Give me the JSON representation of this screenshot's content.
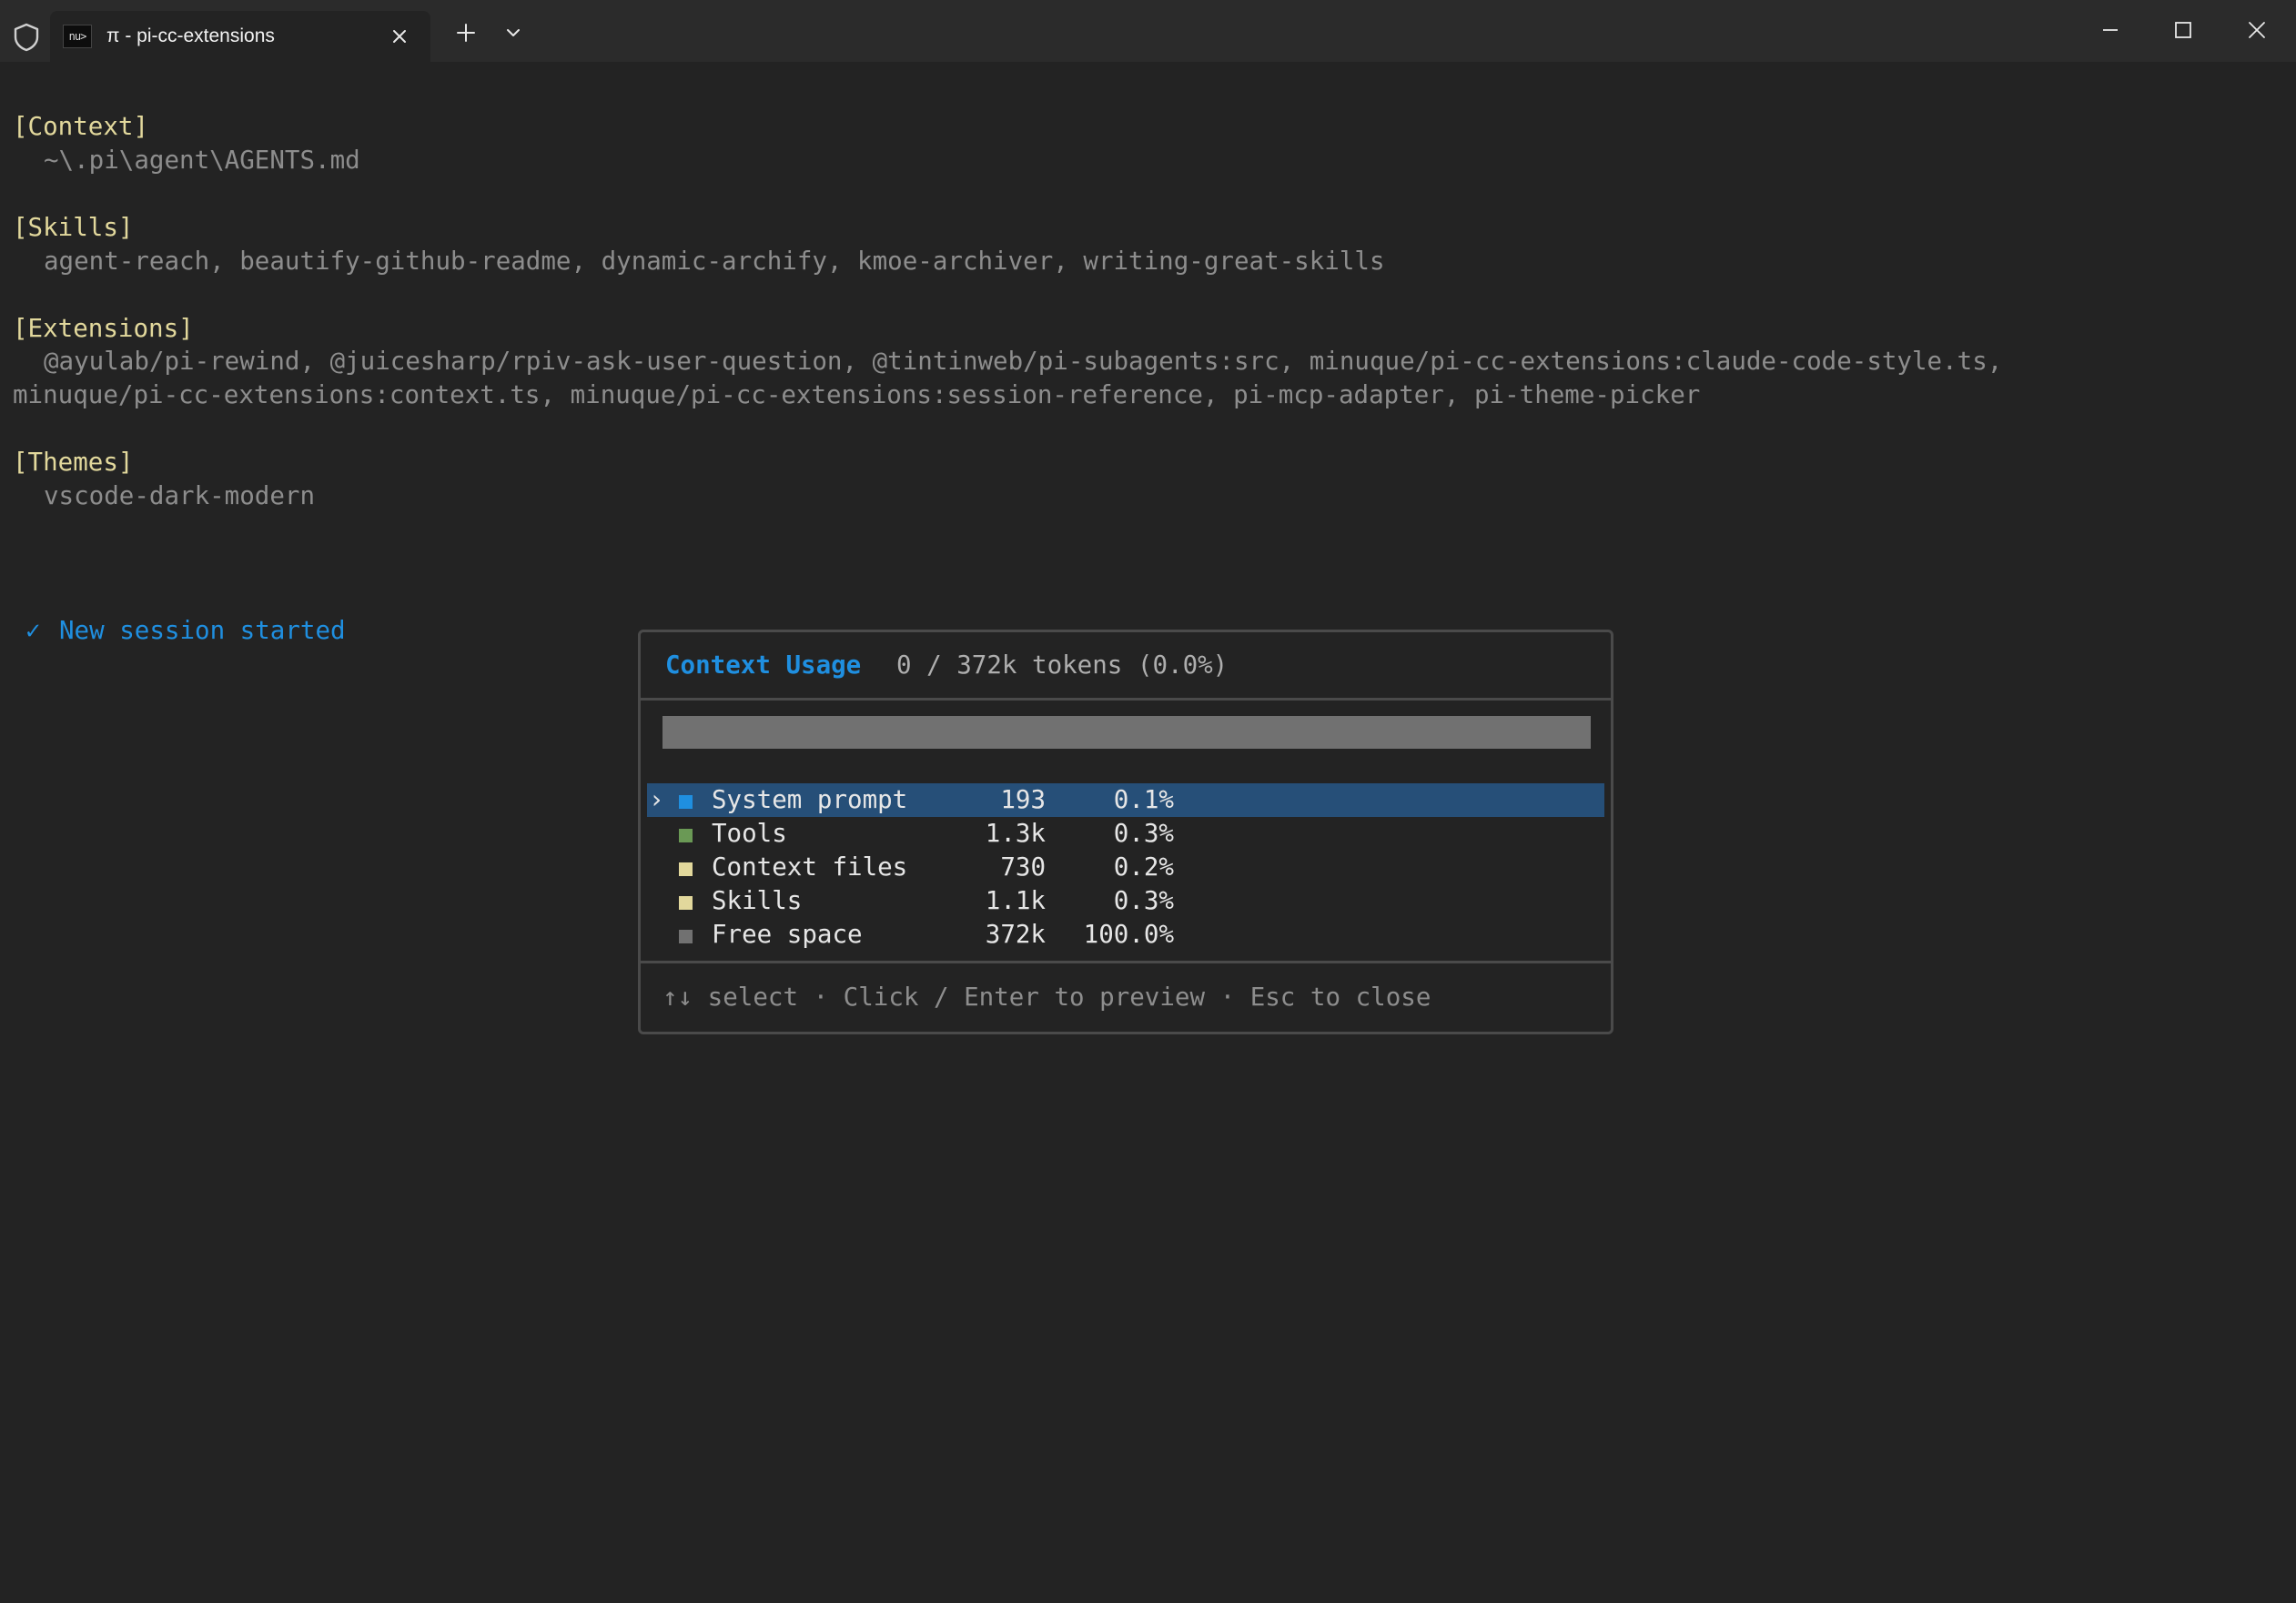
{
  "window": {
    "tab_title": "π - pi-cc-extensions",
    "tab_icon_text": "nu>",
    "icons": {
      "shield": "shield-icon",
      "tab_close": "close-icon",
      "new_tab": "plus-icon",
      "tab_dropdown": "chevron-down-icon",
      "minimize": "minimize-icon",
      "maximize": "maximize-icon",
      "close": "close-icon"
    }
  },
  "terminal": {
    "context_heading": "[Context]",
    "context_value": "~\\.pi\\agent\\AGENTS.md",
    "skills_heading": "[Skills]",
    "skills_value": "agent-reach, beautify-github-readme, dynamic-archify, kmoe-archiver, writing-great-skills",
    "extensions_heading": "[Extensions]",
    "extensions_value_line1": "@ayulab/pi-rewind, @juicesharp/rpiv-ask-user-question, @tintinweb/pi-subagents:src, minuque/pi-cc-extensions:claude-code-style.ts,",
    "extensions_value_line2": "minuque/pi-cc-extensions:context.ts, minuque/pi-cc-extensions:session-reference, pi-mcp-adapter, pi-theme-picker",
    "themes_heading": "[Themes]",
    "themes_value": "vscode-dark-modern",
    "status_check": "✓",
    "status_message": "New session started"
  },
  "context_panel": {
    "title": "Context Usage",
    "summary": "0 / 372k tokens (0.0%)",
    "usage_fraction": 0.0,
    "selected_index": 0,
    "selection_caret": "›",
    "rows": [
      {
        "label": "System prompt",
        "tokens": "193",
        "percent": "0.1%",
        "color": "#1f8fe0"
      },
      {
        "label": "Tools",
        "tokens": "1.3k",
        "percent": "0.3%",
        "color": "#6a9955"
      },
      {
        "label": "Context files",
        "tokens": "730",
        "percent": "0.2%",
        "color": "#e2d89c"
      },
      {
        "label": "Skills",
        "tokens": "1.1k",
        "percent": "0.3%",
        "color": "#e2d89c"
      },
      {
        "label": "Free space",
        "tokens": "372k",
        "percent": "100.0%",
        "color": "#717171"
      }
    ],
    "footer": "↑↓ select · Click / Enter to preview · Esc to close"
  },
  "colors": {
    "background": "#232323",
    "heading": "#e2d89c",
    "accent": "#1f8fe0",
    "selection": "#264f78",
    "muted_text": "#8d8d8d"
  }
}
